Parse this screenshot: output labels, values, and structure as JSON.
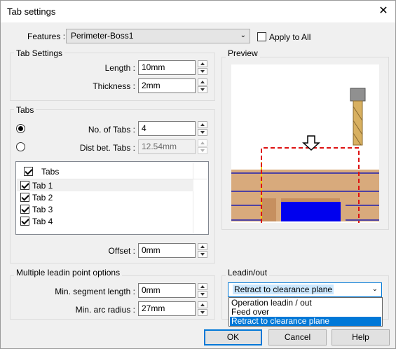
{
  "window": {
    "title": "Tab settings",
    "close_glyph": "✕"
  },
  "features": {
    "label": "Features :",
    "value": "Perimeter-Boss1",
    "apply_all_label": "Apply to All",
    "apply_all_checked": false
  },
  "tab_settings": {
    "title": "Tab Settings",
    "length_label": "Length :",
    "length_value": "10mm",
    "thickness_label": "Thickness :",
    "thickness_value": "2mm"
  },
  "tabs": {
    "title": "Tabs",
    "no_of_tabs_label": "No. of Tabs :",
    "no_of_tabs_value": "4",
    "dist_label": "Dist bet. Tabs :",
    "dist_value": "12.54mm",
    "selected_option": "no_of_tabs",
    "list_header": "Tabs",
    "items": [
      {
        "label": "Tab 1",
        "checked": true
      },
      {
        "label": "Tab 2",
        "checked": true
      },
      {
        "label": "Tab 3",
        "checked": true
      },
      {
        "label": "Tab 4",
        "checked": true
      }
    ],
    "offset_label": "Offset :",
    "offset_value": "0mm"
  },
  "preview": {
    "title": "Preview",
    "colors": {
      "stock": "#d8aa7c",
      "tab": "#0000ee",
      "path": "#dd1111",
      "lines": "#2020b0",
      "tool_flute": "#d8b060"
    }
  },
  "leadin_points": {
    "title": "Multiple leadin point options",
    "min_seg_label": "Min. segment length :",
    "min_seg_value": "0mm",
    "min_arc_label": "Min. arc radius :",
    "min_arc_value": "27mm"
  },
  "leadin_out": {
    "title": "Leadin/out",
    "selected": "Retract to clearance plane",
    "options": [
      "Operation leadin / out",
      "Feed over",
      "Retract to clearance plane"
    ],
    "highlighted_index": 2
  },
  "buttons": {
    "ok": "OK",
    "cancel": "Cancel",
    "help": "Help"
  }
}
